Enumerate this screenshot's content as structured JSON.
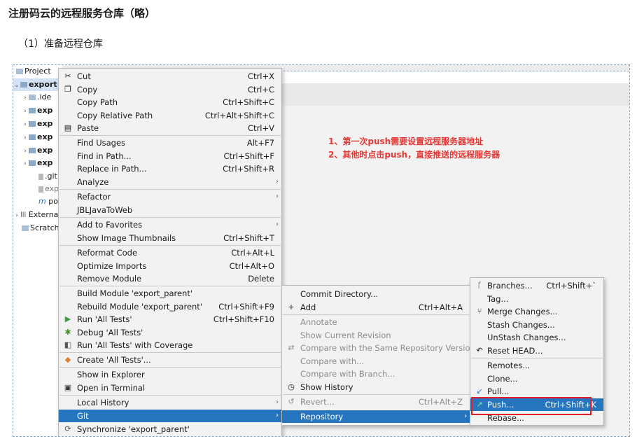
{
  "doc": {
    "heading": "注册码云的远程服务仓库（略）",
    "subheading": "（1）准备远程仓库"
  },
  "annotations": [
    "1、第一次push需要设置远程服务器地址",
    "2、其他时点击push，直接推送的远程服务器"
  ],
  "project_tree": [
    {
      "text": "Project",
      "icon": "project-icon"
    },
    {
      "text": "export",
      "icon": "module-folder-icon",
      "bold": true
    },
    {
      "text": ".ide",
      "icon": "folder-icon"
    },
    {
      "text": "exp",
      "icon": "module-folder-icon",
      "bold": true
    },
    {
      "text": "exp",
      "icon": "module-folder-icon",
      "bold": true
    },
    {
      "text": "exp",
      "icon": "module-folder-icon",
      "bold": true
    },
    {
      "text": "exp",
      "icon": "module-folder-icon",
      "bold": true
    },
    {
      "text": "exp",
      "icon": "module-folder-icon",
      "bold": true
    },
    {
      "text": ".git",
      "icon": "gitignore-file-icon"
    },
    {
      "text": "exp",
      "icon": "iml-file-icon"
    },
    {
      "text": "por",
      "icon": "maven-pom-icon"
    },
    {
      "text": "Externa",
      "icon": "external-libraries-icon"
    },
    {
      "text": "Scratch",
      "icon": "scratches-icon"
    }
  ],
  "context_menu": [
    {
      "label": "Cut",
      "shortcut": "Ctrl+X",
      "icon": "scissors-icon"
    },
    {
      "label": "Copy",
      "shortcut": "Ctrl+C",
      "icon": "copy-icon"
    },
    {
      "label": "Copy Path",
      "shortcut": "Ctrl+Shift+C"
    },
    {
      "label": "Copy Relative Path",
      "shortcut": "Ctrl+Alt+Shift+C"
    },
    {
      "label": "Paste",
      "shortcut": "Ctrl+V",
      "icon": "paste-icon"
    },
    {
      "label": "Find Usages",
      "shortcut": "Alt+F7"
    },
    {
      "label": "Find in Path...",
      "shortcut": "Ctrl+Shift+F"
    },
    {
      "label": "Replace in Path...",
      "shortcut": "Ctrl+Shift+R"
    },
    {
      "label": "Analyze",
      "submenu": true
    },
    {
      "label": "Refactor",
      "submenu": true
    },
    {
      "label": "JBLJavaToWeb"
    },
    {
      "label": "Add to Favorites",
      "submenu": true
    },
    {
      "label": "Show Image Thumbnails",
      "shortcut": "Ctrl+Shift+T"
    },
    {
      "label": "Reformat Code",
      "shortcut": "Ctrl+Alt+L"
    },
    {
      "label": "Optimize Imports",
      "shortcut": "Ctrl+Alt+O"
    },
    {
      "label": "Remove Module",
      "shortcut": "Delete"
    },
    {
      "label": "Build Module 'export_parent'"
    },
    {
      "label": "Rebuild Module 'export_parent'",
      "shortcut": "Ctrl+Shift+F9"
    },
    {
      "label": "Run 'All Tests'",
      "shortcut": "Ctrl+Shift+F10",
      "icon": "run-icon"
    },
    {
      "label": "Debug 'All Tests'",
      "icon": "debug-icon"
    },
    {
      "label": "Run 'All Tests' with Coverage",
      "icon": "coverage-icon"
    },
    {
      "label": "Create 'All Tests'...",
      "icon": "create-config-icon"
    },
    {
      "label": "Show in Explorer"
    },
    {
      "label": "Open in Terminal",
      "icon": "terminal-icon"
    },
    {
      "label": "Local History",
      "submenu": true
    },
    {
      "label": "Git",
      "submenu": true,
      "selected": true
    },
    {
      "label": "Synchronize 'export_parent'",
      "icon": "sync-icon"
    }
  ],
  "git_menu": [
    {
      "label": "Commit Directory..."
    },
    {
      "label": "Add",
      "shortcut": "Ctrl+Alt+A",
      "icon": "plus-icon"
    },
    {
      "label": "Annotate",
      "disabled": true
    },
    {
      "label": "Show Current Revision",
      "disabled": true
    },
    {
      "label": "Compare with the Same Repository Version",
      "disabled": true,
      "icon": "compare-icon"
    },
    {
      "label": "Compare with...",
      "disabled": true
    },
    {
      "label": "Compare with Branch...",
      "disabled": true
    },
    {
      "label": "Show History",
      "icon": "history-icon"
    },
    {
      "label": "Revert...",
      "shortcut": "Ctrl+Alt+Z",
      "disabled": true,
      "icon": "revert-icon"
    },
    {
      "label": "Repository",
      "submenu": true,
      "selected": true
    }
  ],
  "repository_menu": [
    {
      "label": "Branches...",
      "shortcut": "Ctrl+Shift+`",
      "icon": "branch-icon"
    },
    {
      "label": "Tag..."
    },
    {
      "label": "Merge Changes...",
      "icon": "merge-icon"
    },
    {
      "label": "Stash Changes..."
    },
    {
      "label": "UnStash Changes..."
    },
    {
      "label": "Reset HEAD...",
      "icon": "reset-icon"
    },
    {
      "label": "Remotes..."
    },
    {
      "label": "Clone..."
    },
    {
      "label": "Pull...",
      "icon": "pull-icon"
    },
    {
      "label": "Push...",
      "shortcut": "Ctrl+Shift+K",
      "selected": true,
      "icon": "push-icon"
    },
    {
      "label": "Rebase..."
    }
  ],
  "colors": {
    "selection": "#2675bf",
    "menu_bg": "#f2f2f2",
    "annotation": "#e53935",
    "highlight_box": "#e21f26"
  }
}
